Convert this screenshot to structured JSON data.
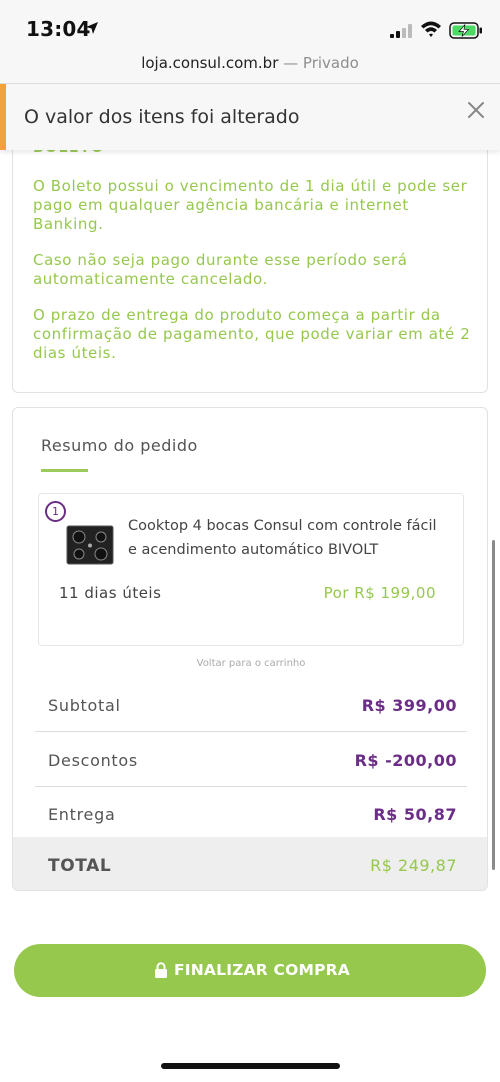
{
  "status_bar": {
    "time": "13:04",
    "icons": [
      "location-arrow-icon",
      "signal-icon",
      "wifi-icon",
      "battery-charging-icon"
    ]
  },
  "browser": {
    "url_domain": "loja.consul.com.br",
    "url_separator": " — ",
    "url_mode": "Privado"
  },
  "banner": {
    "message": "O valor dos itens foi alterado",
    "accent_color": "#f2a23c",
    "close_icon": "close-icon"
  },
  "boleto_info": {
    "cut_heading": "BOLETO",
    "paragraphs": [
      "O Boleto possui o vencimento de 1 dia útil e pode ser pago em qualquer agência bancária e internet Banking.",
      "Caso não seja pago durante esse período será automaticamente cancelado.",
      "O prazo de entrega do produto começa a partir da confirmação de pagamento, que pode variar em até 2 dias úteis."
    ],
    "text_color": "#96c84e"
  },
  "summary": {
    "title": "Resumo do pedido",
    "product": {
      "quantity": "1",
      "name": "Cooktop 4 bocas Consul com controle fácil e acendimento automático BIVOLT",
      "delivery_time": "11 dias úteis",
      "price": "Por R$ 199,00"
    },
    "back_to_cart": "Voltar para o carrinho",
    "rows": [
      {
        "label": "Subtotal",
        "value": "R$ 399,00"
      },
      {
        "label": "Descontos",
        "value": "R$ -200,00"
      },
      {
        "label": "Entrega",
        "value": "R$ 50,87"
      }
    ],
    "total": {
      "label": "TOTAL",
      "value": "R$ 249,87"
    },
    "value_color": "#6b2d86"
  },
  "checkout": {
    "label": "FINALIZAR COMPRA",
    "icon": "lock-icon",
    "color": "#96c84e"
  }
}
